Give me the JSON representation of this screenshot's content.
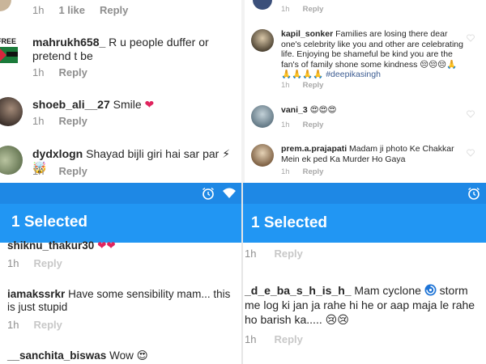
{
  "tl": {
    "top_meta": {
      "time": "1h",
      "likes": "1 like",
      "reply": "Reply"
    },
    "comments": [
      {
        "user": "mahrukh658_",
        "text": "R u people duffer or pretend t be",
        "time": "1h",
        "reply": "Reply",
        "avatar_text": "FREE"
      },
      {
        "user": "shoeb_ali__27",
        "text": "Smile",
        "emoji": "❤",
        "time": "1h",
        "reply": "Reply"
      },
      {
        "user": "dydxlogn",
        "text": "Shayad bijli giri hai sar par",
        "emoji": "⚡🤯",
        "time": "1h",
        "reply": "Reply"
      }
    ]
  },
  "tr": {
    "top_meta": {
      "time": "1h",
      "reply": "Reply"
    },
    "comments": [
      {
        "user": "kapil_sonker",
        "text": "Families are losing there dear one's celebrity like you and other are celebrating life.  Enjoying be shameful be kind you are the fan's of family shone some kindness",
        "emoji": "😔😔😔🙏🙏🙏🙏🙏",
        "hashtag": "#deepikasingh",
        "time": "1h",
        "reply": "Reply"
      },
      {
        "user": "vani_3",
        "text": "",
        "emoji": "😍😍😍",
        "time": "1h",
        "reply": "Reply"
      },
      {
        "user": "prem.a.prajapati",
        "text": "Madam ji photo Ke Chakkar Mein ek ped Ka Murder Ho Gaya",
        "time": "1h",
        "reply": "Reply"
      }
    ]
  },
  "bl": {
    "title": "1 Selected",
    "partial_user": "shiknu_thakur30",
    "partial_emoji": "❤❤",
    "partial_meta": {
      "time": "1h",
      "reply": "Reply"
    },
    "comments": [
      {
        "user": "iamakssrkr",
        "text": "Have some sensibility mam... this is just stupid",
        "time": "1h",
        "reply": "Reply"
      },
      {
        "user": "__sanchita_biswas",
        "text": "Wow",
        "emoji": "😍"
      }
    ]
  },
  "br": {
    "title": "1 Selected",
    "partial_meta": {
      "time": "1h",
      "reply": "Reply"
    },
    "comments": [
      {
        "user": "_d_e_ba_s_h_is_h_",
        "text_a": "Mam cyclone",
        "text_b": "storm me log ki jan ja rahe hi he or aap maja le rahe ho barish ka.....",
        "emoji": "😢😢",
        "time": "1h",
        "reply": "Reply"
      }
    ]
  },
  "colors": {
    "status_bar": "#1e88e5",
    "selection_bar": "#2196f3",
    "meta_text": "#8e8e8e",
    "heart": "#e0245e"
  },
  "icons": [
    "alarm-icon",
    "wifi-icon",
    "heart-outline-icon",
    "cyclone-icon"
  ]
}
